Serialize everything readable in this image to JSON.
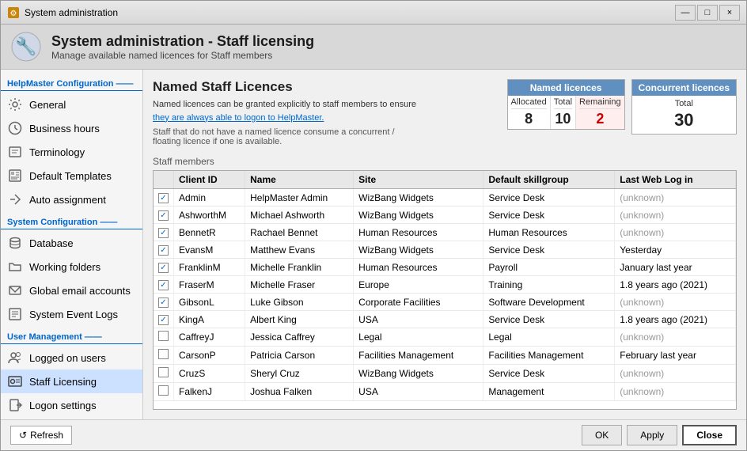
{
  "window": {
    "title": "System administration",
    "close_label": "×",
    "minimize_label": "—",
    "maximize_label": "□"
  },
  "header": {
    "title": "System administration - Staff licensing",
    "subtitle": "Manage available named licences for Staff members"
  },
  "sidebar": {
    "sections": [
      {
        "label": "HelpMaster Configuration",
        "items": [
          {
            "id": "general",
            "label": "General",
            "icon": "gear"
          },
          {
            "id": "business-hours",
            "label": "Business hours",
            "icon": "clock"
          },
          {
            "id": "terminology",
            "label": "Terminology",
            "icon": "text"
          },
          {
            "id": "default-templates",
            "label": "Default Templates",
            "icon": "template"
          },
          {
            "id": "auto-assignment",
            "label": "Auto assignment",
            "icon": "auto"
          }
        ]
      },
      {
        "label": "System Configuration",
        "items": [
          {
            "id": "database",
            "label": "Database",
            "icon": "database"
          },
          {
            "id": "working-folders",
            "label": "Working folders",
            "icon": "folder"
          },
          {
            "id": "global-email",
            "label": "Global email accounts",
            "icon": "email"
          },
          {
            "id": "system-event-logs",
            "label": "System Event Logs",
            "icon": "log"
          }
        ]
      },
      {
        "label": "User Management",
        "items": [
          {
            "id": "logged-on-users",
            "label": "Logged on users",
            "icon": "users"
          },
          {
            "id": "staff-licensing",
            "label": "Staff Licensing",
            "icon": "licence",
            "active": true
          },
          {
            "id": "logon-settings",
            "label": "Logon settings",
            "icon": "logon"
          }
        ]
      }
    ]
  },
  "content": {
    "title": "Named Staff Licences",
    "description_line1": "Named licences can be granted explicitly to staff members to ensure",
    "description_line2": "they are always able to logon to HelpMaster.",
    "description_line3": "Staff that do not have a named licence consume a concurrent /",
    "description_line4": "floating licence if one is available.",
    "staff_members_label": "Staff members"
  },
  "named_licences": {
    "header": "Named licences",
    "columns": [
      {
        "label": "Allocated",
        "value": "8"
      },
      {
        "label": "Total",
        "value": "10"
      },
      {
        "label": "Remaining",
        "value": "2",
        "highlight": true
      }
    ]
  },
  "concurrent_licences": {
    "header": "Concurrent licences",
    "label": "Total",
    "value": "30"
  },
  "table": {
    "columns": [
      "",
      "Client ID",
      "Name",
      "Site",
      "Default skillgroup",
      "Last Web Log in"
    ],
    "rows": [
      {
        "checked": true,
        "client_id": "Admin",
        "name": "HelpMaster Admin",
        "site": "WizBang Widgets",
        "skillgroup": "Service Desk",
        "last_login": "(unknown)"
      },
      {
        "checked": true,
        "client_id": "AshworthM",
        "name": "Michael Ashworth",
        "site": "WizBang Widgets",
        "skillgroup": "Service Desk",
        "last_login": "(unknown)"
      },
      {
        "checked": true,
        "client_id": "BennetR",
        "name": "Rachael Bennet",
        "site": "Human Resources",
        "skillgroup": "Human Resources",
        "last_login": "(unknown)"
      },
      {
        "checked": true,
        "client_id": "EvansM",
        "name": "Matthew Evans",
        "site": "WizBang Widgets",
        "skillgroup": "Service Desk",
        "last_login": "Yesterday"
      },
      {
        "checked": true,
        "client_id": "FranklinM",
        "name": "Michelle Franklin",
        "site": "Human Resources",
        "skillgroup": "Payroll",
        "last_login": "January last year"
      },
      {
        "checked": true,
        "client_id": "FraserM",
        "name": "Michelle Fraser",
        "site": "Europe",
        "skillgroup": "Training",
        "last_login": "1.8 years ago (2021)"
      },
      {
        "checked": true,
        "client_id": "GibsonL",
        "name": "Luke Gibson",
        "site": "Corporate Facilities",
        "skillgroup": "Software Development",
        "last_login": "(unknown)"
      },
      {
        "checked": true,
        "client_id": "KingA",
        "name": "Albert King",
        "site": "USA",
        "skillgroup": "Service Desk",
        "last_login": "1.8 years ago (2021)"
      },
      {
        "checked": false,
        "client_id": "CaffreyJ",
        "name": "Jessica Caffrey",
        "site": "Legal",
        "skillgroup": "Legal",
        "last_login": "(unknown)"
      },
      {
        "checked": false,
        "client_id": "CarsonP",
        "name": "Patricia Carson",
        "site": "Facilities Management",
        "skillgroup": "Facilities Management",
        "last_login": "February last year"
      },
      {
        "checked": false,
        "client_id": "CruzS",
        "name": "Sheryl Cruz",
        "site": "WizBang Widgets",
        "skillgroup": "Service Desk",
        "last_login": "(unknown)"
      },
      {
        "checked": false,
        "client_id": "FalkenJ",
        "name": "Joshua Falken",
        "site": "USA",
        "skillgroup": "Management",
        "last_login": "(unknown)"
      }
    ]
  },
  "buttons": {
    "refresh": "↺ Refresh",
    "ok": "OK",
    "apply": "Apply",
    "close": "Close"
  }
}
